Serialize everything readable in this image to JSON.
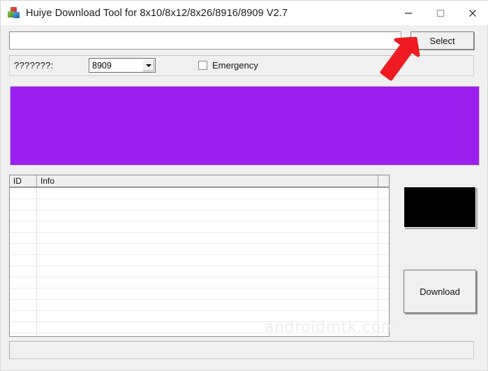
{
  "window": {
    "title": "Huiye Download Tool for 8x10/8x12/8x26/8916/8909 V2.7",
    "app_icon": "blocks-icon",
    "controls": {
      "minimize": "minimize-icon",
      "maximize": "maximize-icon",
      "close": "close-icon"
    }
  },
  "toolbar": {
    "path_value": "",
    "path_placeholder": "",
    "select_label": "Select"
  },
  "options": {
    "chip_label": "???????:",
    "chip_value": "8909",
    "chip_options": [
      "8909"
    ],
    "emergency_label": "Emergency",
    "emergency_checked": false
  },
  "panels": {
    "progress_color": "#9c1ff0",
    "preview_color": "#000000"
  },
  "list": {
    "columns": [
      "ID",
      "Info"
    ],
    "rows": []
  },
  "actions": {
    "download_label": "Download"
  },
  "status": {
    "text": ""
  },
  "watermark": {
    "text": "androidmtk.com"
  },
  "annotation": {
    "arrow_color": "#ee1c22",
    "points_to": "select-button"
  }
}
